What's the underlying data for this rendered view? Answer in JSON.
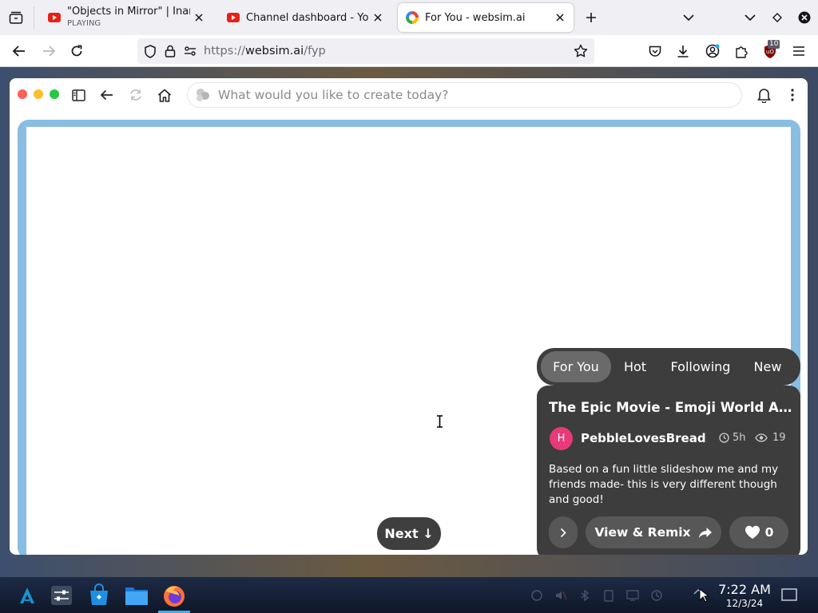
{
  "browser": {
    "tabs": [
      {
        "title": "\"Objects in Mirror\" | Inanimate Insanity",
        "subtitle": "PLAYING",
        "favicon": "youtube-icon",
        "active": false
      },
      {
        "title": "Channel dashboard - YouTube Studio",
        "favicon": "youtube-icon",
        "active": false
      },
      {
        "title": "For You - websim.ai",
        "favicon": "websim-icon",
        "active": true
      }
    ],
    "url": {
      "scheme": "https://",
      "host": "websim.ai",
      "path": "/fyp"
    },
    "extension_badge": "10"
  },
  "app": {
    "prompt_placeholder": "What would you like to create today?",
    "next_label": "Next ↓",
    "feed_tabs": [
      {
        "label": "For You",
        "active": true
      },
      {
        "label": "Hot",
        "active": false
      },
      {
        "label": "Following",
        "active": false
      },
      {
        "label": "New",
        "active": false
      }
    ],
    "card": {
      "title": "The Epic Movie - Emoji World Adventure",
      "avatar_initial": "H",
      "author": "PebbleLovesBread",
      "age": "5h",
      "views": "19",
      "description": "Based on a fun little slideshow me and my friends made- this is very different though and good!",
      "view_remix_label": "View & Remix",
      "likes": "0"
    }
  },
  "taskbar": {
    "time": "7:22 AM",
    "date": "12/3/24"
  },
  "colors": {
    "accent_red": "#e62117",
    "card_bg": "#3d3d3d",
    "frame_border": "#89bde2",
    "avatar": "#e83a78"
  }
}
